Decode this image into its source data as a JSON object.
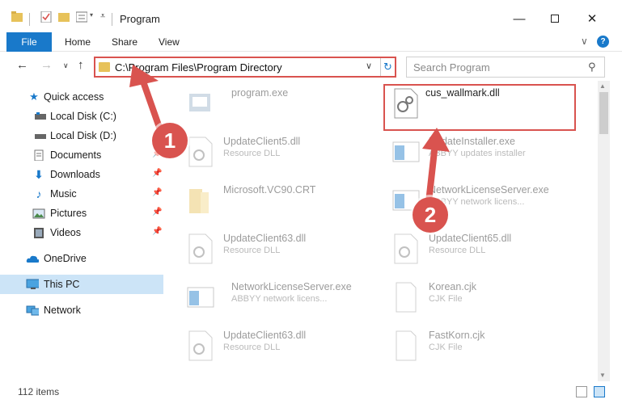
{
  "window": {
    "title": "Program"
  },
  "ribbon": {
    "file": "File",
    "home": "Home",
    "share": "Share",
    "view": "View"
  },
  "nav": {
    "address": "C:\\Program Files\\Program Directory",
    "search_placeholder": "Search Program"
  },
  "sidebar": {
    "items": [
      {
        "label": "Quick access"
      },
      {
        "label": "Local Disk (C:)"
      },
      {
        "label": "Local Disk (D:)"
      },
      {
        "label": "Documents"
      },
      {
        "label": "Downloads"
      },
      {
        "label": "Music"
      },
      {
        "label": "Pictures"
      },
      {
        "label": "Videos"
      },
      {
        "label": "OneDrive"
      },
      {
        "label": "This PC"
      },
      {
        "label": "Network"
      }
    ]
  },
  "files": [
    {
      "name": "program.exe",
      "sub": ""
    },
    {
      "name": "cus_wallmark.dll",
      "sub": ""
    },
    {
      "name": "UpdateClient5.dll",
      "sub": "Resource DLL"
    },
    {
      "name": "UpdateInstaller.exe",
      "sub": "ABBYY updates installer"
    },
    {
      "name": "Microsoft.VC90.CRT",
      "sub": ""
    },
    {
      "name": "NetworkLicenseServer.exe",
      "sub": "ABBYY network licens..."
    },
    {
      "name": "UpdateClient63.dll",
      "sub": "Resource DLL"
    },
    {
      "name": "UpdateClient65.dll",
      "sub": "Resource DLL"
    },
    {
      "name": "NetworkLicenseServer.exe",
      "sub": "ABBYY network licens..."
    },
    {
      "name": "Korean.cjk",
      "sub": "CJK File"
    },
    {
      "name": "UpdateClient63.dll",
      "sub": "Resource DLL"
    },
    {
      "name": "FastKorn.cjk",
      "sub": "CJK File"
    }
  ],
  "status": {
    "count": "112 items"
  },
  "annotations": {
    "step1": "1",
    "step2": "2"
  },
  "colors": {
    "accent": "#1979ca",
    "annotation": "#d9534f",
    "folder": "#e7c25a"
  }
}
